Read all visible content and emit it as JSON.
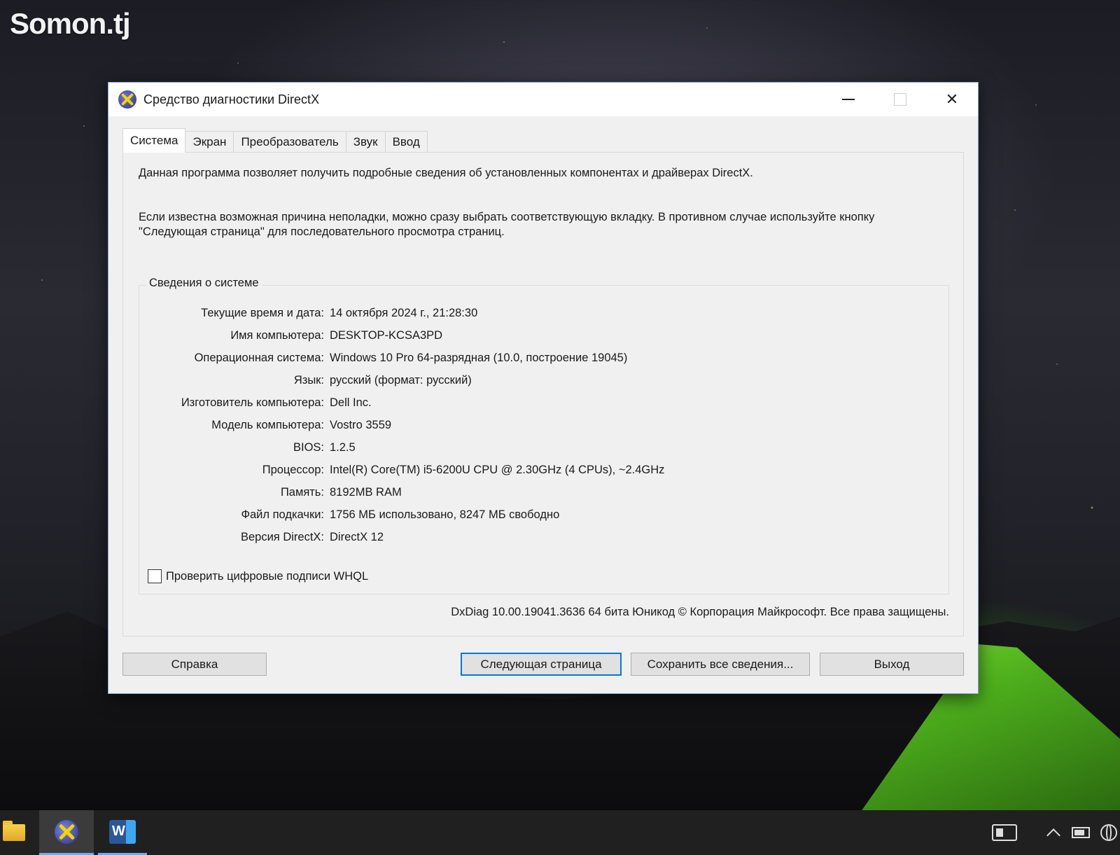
{
  "watermark": "Somon.tj",
  "window": {
    "title": "Средство диагностики DirectX",
    "controls": [
      "minimize",
      "maximize",
      "close"
    ]
  },
  "tabs": [
    {
      "label": "Система",
      "active": true
    },
    {
      "label": "Экран",
      "active": false
    },
    {
      "label": "Преобразователь",
      "active": false
    },
    {
      "label": "Звук",
      "active": false
    },
    {
      "label": "Ввод",
      "active": false
    }
  ],
  "intro": {
    "line1": "Данная программа позволяет получить подробные сведения об установленных компонентах и драйверах DirectX.",
    "line2": "Если известна возможная причина неполадки, можно сразу выбрать соответствующую вкладку. В противном случае используйте кнопку \"Следующая страница\" для последовательного просмотра страниц."
  },
  "system_info": {
    "group_title": "Сведения о системе",
    "rows": [
      {
        "label": "Текущие время и дата:",
        "value": "14 октября 2024 г., 21:28:30"
      },
      {
        "label": "Имя компьютера:",
        "value": "DESKTOP-KCSA3PD"
      },
      {
        "label": "Операционная система:",
        "value": "Windows 10 Pro 64-разрядная (10.0, построение 19045)"
      },
      {
        "label": "Язык:",
        "value": "русский (формат: русский)"
      },
      {
        "label": "Изготовитель компьютера:",
        "value": "Dell Inc."
      },
      {
        "label": "Модель компьютера:",
        "value": "Vostro 3559"
      },
      {
        "label": "BIOS:",
        "value": "1.2.5"
      },
      {
        "label": "Процессор:",
        "value": "Intel(R) Core(TM) i5-6200U CPU @ 2.30GHz (4 CPUs), ~2.4GHz"
      },
      {
        "label": "Память:",
        "value": "8192MB RAM"
      },
      {
        "label": "Файл подкачки:",
        "value": "1756 МБ использовано, 8247 МБ свободно"
      },
      {
        "label": "Версия DirectX:",
        "value": "DirectX 12"
      }
    ],
    "whql_label": "Проверить цифровые подписи WHQL",
    "whql_checked": false
  },
  "copyright": "DxDiag 10.00.19041.3636 64 бита Юникод © Корпорация Майкрософт. Все права защищены.",
  "buttons": {
    "help": "Справка",
    "next": "Следующая страница",
    "save": "Сохранить все сведения...",
    "exit": "Выход"
  },
  "taskbar": {
    "apps": [
      "file-explorer-icon",
      "directx-diagnostic-icon",
      "word-icon"
    ],
    "tray": [
      "news-icon",
      "chevron-up-icon",
      "battery-icon",
      "globe-icon"
    ]
  }
}
